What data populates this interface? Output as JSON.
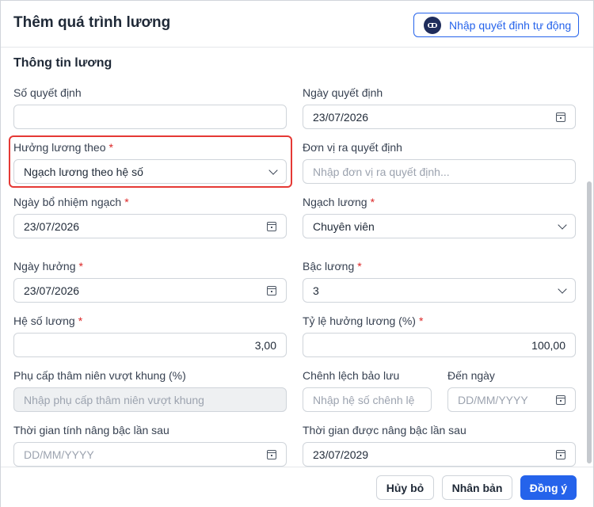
{
  "dialog": {
    "title": "Thêm quá trình lương",
    "auto_button_label": "Nhập quyết định tự động"
  },
  "section_title": "Thông tin lương",
  "fields": {
    "so_quyet_dinh": {
      "label": "Số quyết định",
      "value": ""
    },
    "ngay_quyet_dinh": {
      "label": "Ngày quyết định",
      "value": "23/07/2026"
    },
    "huong_luong_theo": {
      "label": "Hưởng lương theo",
      "value": "Ngạch lương theo hệ số"
    },
    "don_vi_ra_quyet_dinh": {
      "label": "Đơn vị ra quyết định",
      "placeholder": "Nhập đơn vị ra quyết định..."
    },
    "ngay_bo_nhiem_ngach": {
      "label": "Ngày bổ nhiệm ngạch",
      "value": "23/07/2026"
    },
    "ngach_luong": {
      "label": "Ngạch lương",
      "value": "Chuyên viên"
    },
    "ngay_huong": {
      "label": "Ngày hưởng",
      "value": "23/07/2026"
    },
    "bac_luong": {
      "label": "Bậc lương",
      "value": "3"
    },
    "he_so_luong": {
      "label": "Hệ số lương",
      "value": "3,00"
    },
    "ty_le_huong_luong": {
      "label": "Tỷ lệ hưởng lương (%)",
      "value": "100,00"
    },
    "phu_cap_tham_nien": {
      "label": "Phụ cấp thâm niên vượt khung (%)",
      "placeholder": "Nhập phụ cấp thâm niên vượt khung"
    },
    "chenh_lech_bao_luu": {
      "label": "Chênh lệch bảo lưu",
      "placeholder": "Nhập hệ số chênh lệ"
    },
    "den_ngay": {
      "label": "Đến ngày",
      "placeholder": "DD/MM/YYYY"
    },
    "thoi_gian_tinh_nang_bac": {
      "label": "Thời gian tính nâng bậc lần sau",
      "placeholder": "DD/MM/YYYY"
    },
    "thoi_gian_duoc_nang_bac": {
      "label": "Thời gian được nâng bậc lần sau",
      "value": "23/07/2029"
    }
  },
  "required_mark": "*",
  "footer": {
    "cancel_label": "Hủy bỏ",
    "duplicate_label": "Nhân bản",
    "agree_label": "Đồng ý"
  },
  "colors": {
    "primary": "#2563eb",
    "highlight": "#e53935",
    "required": "#dc2626"
  }
}
